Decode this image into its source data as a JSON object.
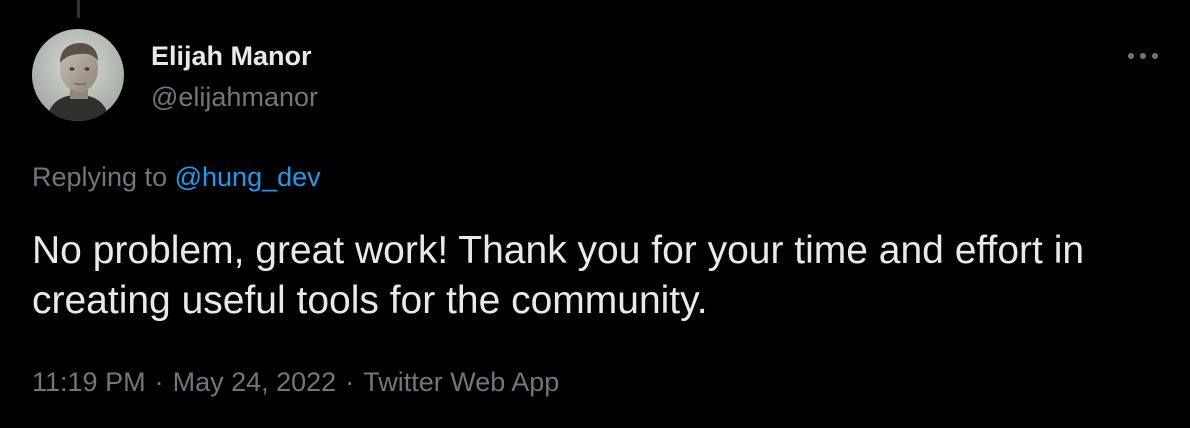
{
  "author": {
    "display_name": "Elijah Manor",
    "handle": "@elijahmanor"
  },
  "reply": {
    "prefix": "Replying to",
    "target": "@hung_dev"
  },
  "tweet": {
    "text": "No problem, great work! Thank you for your time and effort in creating useful tools for the community."
  },
  "meta": {
    "time": "11:19 PM",
    "date": "May 24, 2022",
    "source": "Twitter Web App",
    "separator": "·"
  },
  "icons": {
    "more": "more-horizontal-icon",
    "avatar": "avatar"
  },
  "colors": {
    "background": "#000000",
    "primary_text": "#e7e9ea",
    "secondary_text": "#71767b",
    "link": "#1d9bf0"
  }
}
